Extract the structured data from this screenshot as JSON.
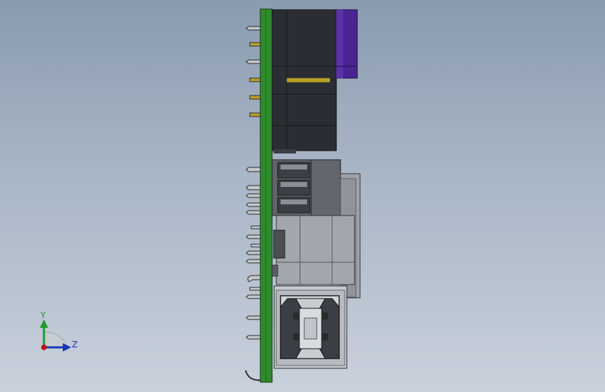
{
  "viewport": {
    "background_top": "#8a9bb0",
    "background_bottom": "#c9d1dc"
  },
  "model": {
    "pcb_color": "#2f8a2c",
    "connector_color": "#2a2d33",
    "knob_color": "#4a2590",
    "pin_color": "#b9a12a",
    "terminal_color": "#5f636a",
    "usb_shell_color": "#c7cbd1"
  },
  "triad": {
    "y_label": "Y",
    "z_label": "Z",
    "y_color": "#1f9a2a",
    "z_color": "#1b34b8",
    "x_color": "#c0141c"
  }
}
